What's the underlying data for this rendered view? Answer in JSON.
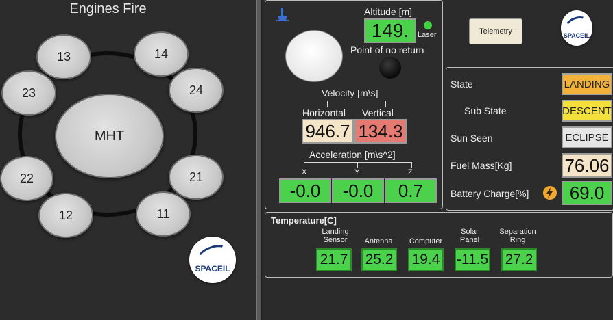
{
  "engines": {
    "title": "Engines Fire",
    "center": "MHT",
    "items": [
      {
        "id": "13",
        "label": "13"
      },
      {
        "id": "14",
        "label": "14"
      },
      {
        "id": "23",
        "label": "23"
      },
      {
        "id": "24",
        "label": "24"
      },
      {
        "id": "22",
        "label": "22"
      },
      {
        "id": "21",
        "label": "21"
      },
      {
        "id": "12",
        "label": "12"
      },
      {
        "id": "11",
        "label": "11"
      }
    ]
  },
  "logo": {
    "text": "SPACEIL"
  },
  "altitude": {
    "label": "Altitude [m]",
    "value": "149.",
    "laser_label": "Laser",
    "ponr_label": "Point of no return"
  },
  "velocity": {
    "label": "Velocity [m\\s]",
    "horizontal_label": "Horizontal",
    "vertical_label": "Vertical",
    "horizontal_value": "946.7",
    "vertical_value": "134.3"
  },
  "acceleration": {
    "label": "Acceleration [m\\s^2]",
    "x_label": "X",
    "y_label": "Y",
    "z_label": "Z",
    "x_value": "-0.0",
    "y_value": "-0.0",
    "z_value": "0.7"
  },
  "telemetry_button": "Telemetry",
  "status": {
    "state_label": "State",
    "state_value": "LANDING",
    "substate_label": "Sub State",
    "substate_value": "DESCENT",
    "sun_label": "Sun Seen",
    "sun_value": "ECLIPSE",
    "fuel_label": "Fuel Mass[Kg]",
    "fuel_value": "76.06",
    "battery_label": "Battery Charge[%]",
    "battery_value": "69.0"
  },
  "temperature": {
    "title": "Temperature[C]",
    "items": [
      {
        "label": "Landing Sensor",
        "value": "21.7"
      },
      {
        "label": "Antenna",
        "value": "25.2"
      },
      {
        "label": "Computer",
        "value": "19.4"
      },
      {
        "label": "Solar Panel",
        "value": "-11.5"
      },
      {
        "label": "Separation Ring",
        "value": "27.2"
      }
    ]
  },
  "colors": {
    "green": "#4cd14c",
    "cream": "#f4e4c8",
    "red": "#e47a72",
    "landing": "#f2b23a",
    "descent": "#f3e03a",
    "eclipse": "#e6e6e6"
  }
}
